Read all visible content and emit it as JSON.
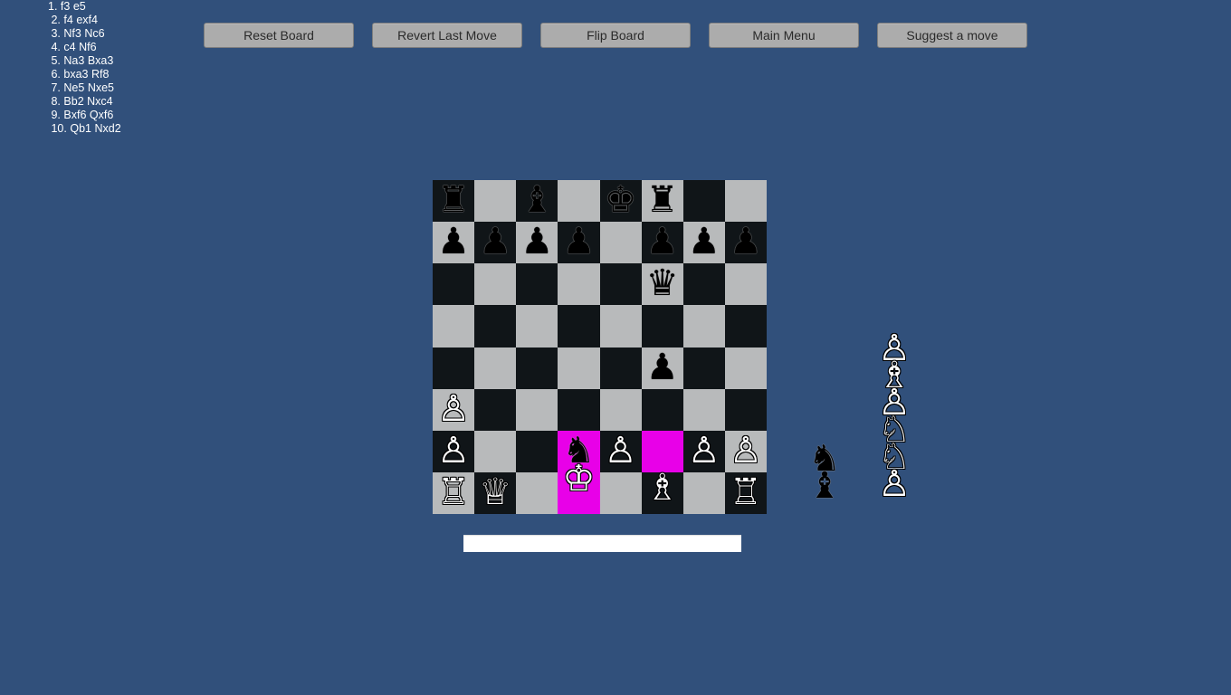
{
  "move_list": [
    {
      "num": "1.",
      "white": "f3",
      "black": "e5"
    },
    {
      "num": "2.",
      "white": "f4",
      "black": "exf4"
    },
    {
      "num": "3.",
      "white": "Nf3",
      "black": "Nc6"
    },
    {
      "num": "4.",
      "white": "c4",
      "black": "Nf6"
    },
    {
      "num": "5.",
      "white": "Na3",
      "black": "Bxa3"
    },
    {
      "num": "6.",
      "white": "bxa3",
      "black": "Rf8"
    },
    {
      "num": "7.",
      "white": "Ne5",
      "black": "Nxe5"
    },
    {
      "num": "8.",
      "white": "Bb2",
      "black": "Nxc4"
    },
    {
      "num": "9.",
      "white": "Bxf6",
      "black": "Qxf6"
    },
    {
      "num": "10.",
      "white": "Qb1",
      "black": "Nxd2"
    }
  ],
  "toolbar": {
    "reset_label": "Reset Board",
    "revert_label": "Revert Last Move",
    "flip_label": "Flip Board",
    "menu_label": "Main Menu",
    "suggest_label": "Suggest a move"
  },
  "colors": {
    "background": "#31507b",
    "dark_square": "#101518",
    "light_square": "#b8babb",
    "highlight": "#e800e8",
    "button": "#acacac"
  },
  "board": {
    "orientation": "white-bottom",
    "highlighted_squares": [
      "d2",
      "d1",
      "f2"
    ],
    "ranks": [
      [
        "bR",
        "",
        "bB",
        "",
        "bK",
        "bR",
        "",
        ""
      ],
      [
        "bP",
        "bP",
        "bP",
        "bP",
        "",
        "bP",
        "bP",
        "bP"
      ],
      [
        "",
        "",
        "",
        "",
        "",
        "bQ",
        "",
        ""
      ],
      [
        "",
        "",
        "",
        "",
        "",
        "",
        "",
        ""
      ],
      [
        "",
        "",
        "",
        "",
        "",
        "bP",
        "",
        ""
      ],
      [
        "wP",
        "",
        "",
        "",
        "",
        "",
        "",
        ""
      ],
      [
        "wP",
        "",
        "",
        "bN",
        "wP",
        "",
        "wP",
        "wP"
      ],
      [
        "wR",
        "wQ",
        "",
        "wK",
        "",
        "wB",
        "",
        "wR"
      ]
    ]
  },
  "captured": {
    "black_pieces": [
      "bN",
      "bB"
    ],
    "white_pieces": [
      "wP",
      "wB",
      "wP",
      "wN",
      "wN",
      "wP"
    ]
  },
  "move_input": {
    "value": "",
    "placeholder": ""
  },
  "pieces": {
    "wK": "♔",
    "wQ": "♕",
    "wR": "♖",
    "wB": "♗",
    "wN": "♘",
    "wP": "♙",
    "bK": "♚",
    "bQ": "♛",
    "bR": "♜",
    "bB": "♝",
    "bN": "♞",
    "bP": "♟",
    "names": {
      "K": "king",
      "Q": "queen",
      "R": "rook",
      "B": "bishop",
      "N": "knight",
      "P": "pawn"
    }
  }
}
